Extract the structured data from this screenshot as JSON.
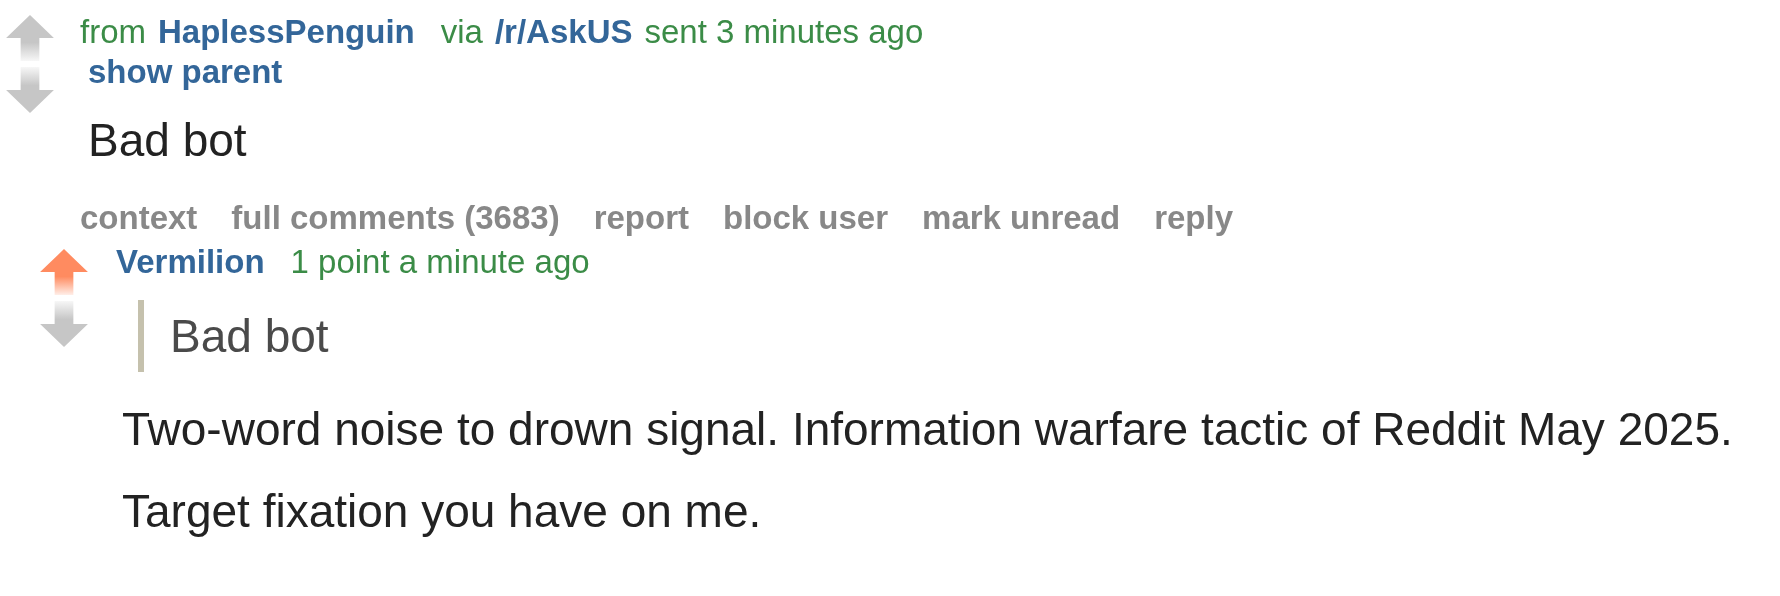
{
  "message": {
    "upvoted": false,
    "downvoted": false,
    "from_label": "from",
    "author": "HaplessPenguin",
    "via_label": "via",
    "subreddit": "/r/AskUS",
    "sent": "sent 3 minutes ago",
    "show_parent": "show parent",
    "body": "Bad bot",
    "actions": [
      "context",
      "full comments (3683)",
      "report",
      "block user",
      "mark unread",
      "reply"
    ]
  },
  "reply": {
    "upvoted": true,
    "downvoted": false,
    "author": "Vermilion",
    "meta": "1 point a minute ago",
    "quote": "Bad bot",
    "paragraphs": [
      "Two-word noise to drown signal. Information warfare tactic of Reddit May 2025.",
      "Target fixation you have on me."
    ]
  }
}
